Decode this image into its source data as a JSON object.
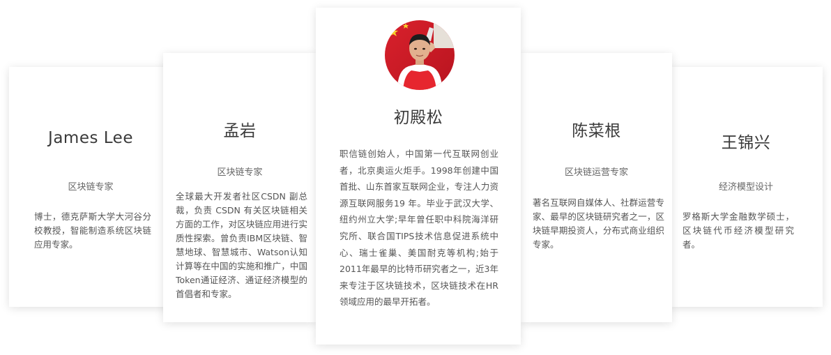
{
  "cards": [
    {
      "name": "James Lee",
      "role": "区块链专家",
      "bio": "博士，德克萨斯大学大河谷分校教授，智能制造系统区块链应用专家。"
    },
    {
      "name": "孟岩",
      "role": "区块链专家",
      "bio": "全球最大开发者社区CSDN 副总裁，负责 CSDN 有关区块链相关方面的工作，对区块链应用进行实质性探索。曾负责IBM区块链、智慧地球、智慧城市、Watson认知计算等在中国的实施和推广，中国Token通证经济、通证经济模型的首倡者和专家。"
    },
    {
      "name": "初殿松",
      "role": "",
      "avatar_icon": "person-portrait",
      "bio": "职信链创始人，中国第一代互联网创业者，北京奥运火炬手。1998年创建中国首批、山东首家互联网企业，专注人力资源互联网服务19 年。毕业于武汉大学、纽约州立大学;早年曾任职中科院海洋研究所、联合国TIPS技术信息促进系统中心、瑞士雀巢、美国耐克等机构;始于 2011年最早的比特币研究者之一，近3年来专注于区块链技术，区块链技术在HR领域应用的最早开拓者。"
    },
    {
      "name": "陈菜根",
      "role": "区块链运营专家",
      "bio": "著名互联网自媒体人、社群运营专家、最早的区块链研究者之一，区块链早期投资人，分布式商业组织专家。"
    },
    {
      "name": "王锦兴",
      "role": "经济模型设计",
      "bio": "罗格斯大学金融数学硕士，区块链代币经济模型研究者。"
    }
  ]
}
